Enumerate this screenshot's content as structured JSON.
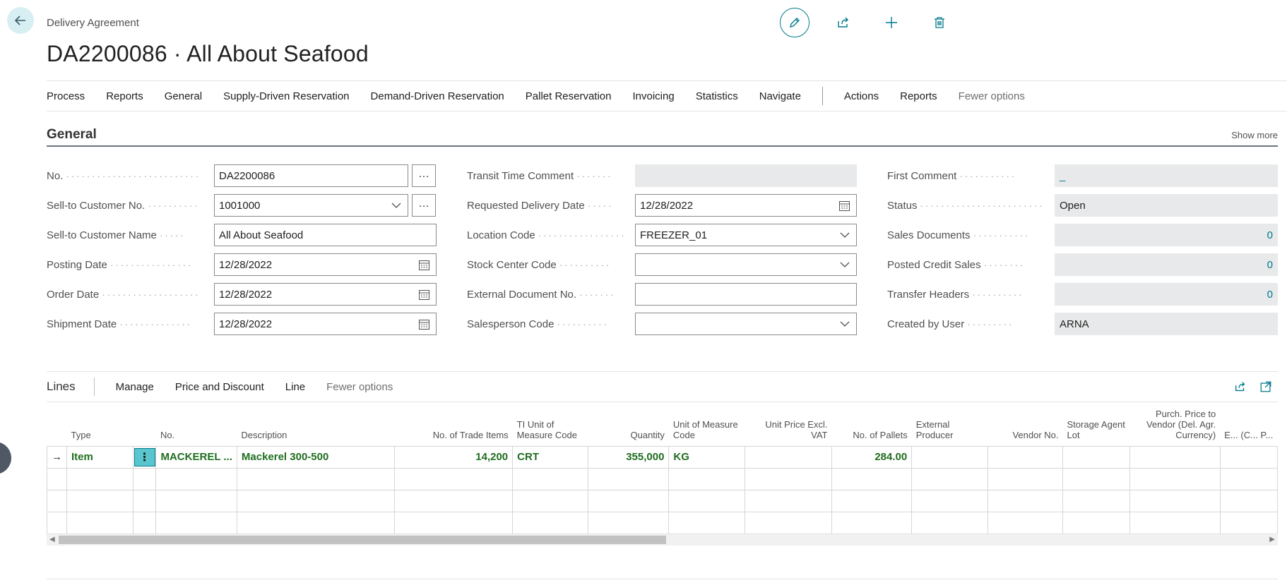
{
  "header": {
    "breadcrumb": "Delivery Agreement",
    "title": "DA2200086 · All About Seafood",
    "actions": [
      "pencil-icon",
      "share-icon",
      "plus-icon",
      "trash-icon"
    ]
  },
  "action_bar": {
    "items": [
      "Process",
      "Reports",
      "General",
      "Supply-Driven Reservation",
      "Demand-Driven Reservation",
      "Pallet Reservation",
      "Invoicing",
      "Statistics",
      "Navigate"
    ],
    "items_after_sep": [
      "Actions",
      "Reports"
    ],
    "fewer_options": "Fewer options"
  },
  "general": {
    "title": "General",
    "show_more": "Show more",
    "col1": [
      {
        "label": "No.",
        "value": "DA2200086"
      },
      {
        "label": "Sell-to Customer No.",
        "value": "1001000"
      },
      {
        "label": "Sell-to Customer Name",
        "value": "All About Seafood"
      },
      {
        "label": "Posting Date",
        "value": "12/28/2022"
      },
      {
        "label": "Order Date",
        "value": "12/28/2022"
      },
      {
        "label": "Shipment Date",
        "value": "12/28/2022"
      }
    ],
    "col2": [
      {
        "label": "Transit Time Comment",
        "value": ""
      },
      {
        "label": "Requested Delivery Date",
        "value": "12/28/2022"
      },
      {
        "label": "Location Code",
        "value": "FREEZER_01"
      },
      {
        "label": "Stock Center Code",
        "value": ""
      },
      {
        "label": "External Document No.",
        "value": ""
      },
      {
        "label": "Salesperson Code",
        "value": ""
      }
    ],
    "col3": [
      {
        "label": "First Comment",
        "value": "_"
      },
      {
        "label": "Status",
        "value": "Open"
      },
      {
        "label": "Sales Documents",
        "value": "0"
      },
      {
        "label": "Posted Credit Sales",
        "value": "0"
      },
      {
        "label": "Transfer Headers",
        "value": "0"
      },
      {
        "label": "Created by User",
        "value": "ARNA"
      }
    ]
  },
  "lines": {
    "title": "Lines",
    "items": [
      "Manage",
      "Price and Discount",
      "Line"
    ],
    "fewer_options": "Fewer options",
    "columns": [
      "Type",
      "No.",
      "Description",
      "No. of Trade Items",
      "TI Unit of Measure Code",
      "Quantity",
      "Unit of Measure Code",
      "Unit Price Excl. VAT",
      "No. of Pallets",
      "External Producer",
      "Vendor No.",
      "Storage Agent Lot",
      "Purch. Price to Vendor (Del. Agr. Currency)",
      "E... (C... P..."
    ],
    "rows": [
      {
        "type": "Item",
        "no": "MACKEREL ...",
        "description": "Mackerel 300-500",
        "trade_items": "14,200",
        "ti_uom": "CRT",
        "quantity": "355,000",
        "uom": "KG",
        "unit_price": "",
        "pallets": "284.00",
        "ext_producer": "",
        "vendor_no": "",
        "storage_lot": "",
        "purch_price": ""
      }
    ]
  },
  "colors": {
    "accent": "#00798c",
    "line_value": "#1f6e1f"
  }
}
